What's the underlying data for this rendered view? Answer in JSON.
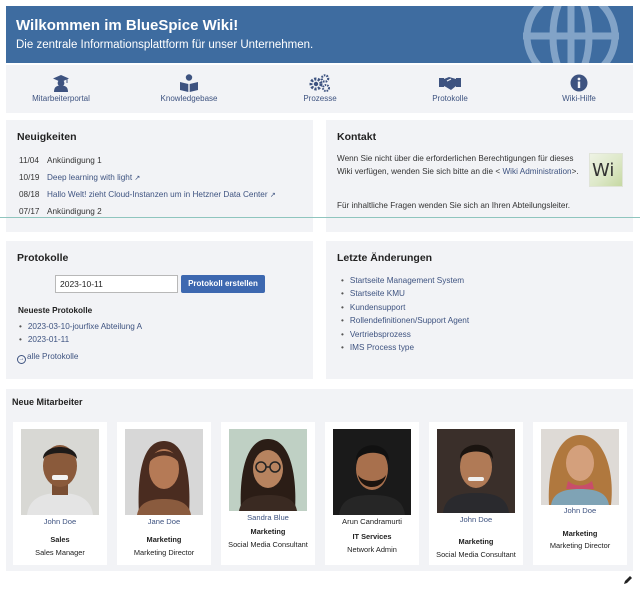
{
  "banner": {
    "title": "Wilkommen im BlueSpice Wiki!",
    "subtitle": "Die zentrale Informationsplattform für unser Unternehmen."
  },
  "nav": [
    {
      "label": "Mitarbeiterportal",
      "icon": "user-graduate-icon"
    },
    {
      "label": "Knowledgebase",
      "icon": "book-reader-icon"
    },
    {
      "label": "Prozesse",
      "icon": "cogs-icon"
    },
    {
      "label": "Protokolle",
      "icon": "handshake-icon"
    },
    {
      "label": "Wiki-Hilfe",
      "icon": "info-circle-icon"
    }
  ],
  "news": {
    "title": "Neuigkeiten",
    "items": [
      {
        "date": "11/04",
        "text": "Ankündigung 1",
        "link": false
      },
      {
        "date": "10/19",
        "text": "Deep learning with light",
        "link": true
      },
      {
        "date": "08/18",
        "text": "Hallo Welt! zieht Cloud-Instanzen um in Hetzner Data Center",
        "link": true
      },
      {
        "date": "07/17",
        "text": "Ankündigung 2",
        "link": false
      }
    ]
  },
  "contact": {
    "title": "Kontakt",
    "line1": "Wenn Sie nicht über die erforderlichen Berechtigungen für dieses",
    "line2_pre": "Wiki verfügen, wenden Sie sich bitte an die <",
    "line2_link": "Wiki Administration",
    "line2_post": ">.",
    "line3": "Für inhaltliche Fragen wenden Sie sich an Ihren Abteilungsleiter.",
    "logo_text": "Wi"
  },
  "protocols": {
    "title": "Protokolle",
    "date_value": "2023-10-11",
    "button": "Protokoll erstellen",
    "latest_heading": "Neueste Protokolle",
    "items": [
      "2023-03-10-jourfixe Abteilung A",
      "2023-01-11"
    ],
    "all_link": "alle Protokolle"
  },
  "changes": {
    "title": "Letzte Änderungen",
    "items": [
      "Startseite Management System",
      "Startseite KMU",
      "Kundensupport",
      "Rollendefinitionen/Support Agent",
      "Vertriebsprozess",
      "IMS Process type"
    ]
  },
  "employees": {
    "title": "Neue Mitarbeiter",
    "people": [
      {
        "name": "John Doe",
        "dept": "Sales",
        "role": "Sales Manager"
      },
      {
        "name": "Jane Doe",
        "dept": "Marketing",
        "role": "Marketing Director"
      },
      {
        "name": "Sandra Blue",
        "dept": "Marketing",
        "role": "Social Media Consultant"
      },
      {
        "name": "Arun Candramurti",
        "dept": "IT Services",
        "role": "Network Admin"
      },
      {
        "name": "John Doe",
        "dept": "Marketing",
        "role": "Social Media Consultant"
      },
      {
        "name": "John Doe",
        "dept": "Marketing",
        "role": "Marketing Director"
      }
    ]
  },
  "colors": {
    "banner": "#3e6ca0",
    "panel": "#f2f3f6",
    "link": "#3e5380",
    "button": "#3d68b0"
  }
}
